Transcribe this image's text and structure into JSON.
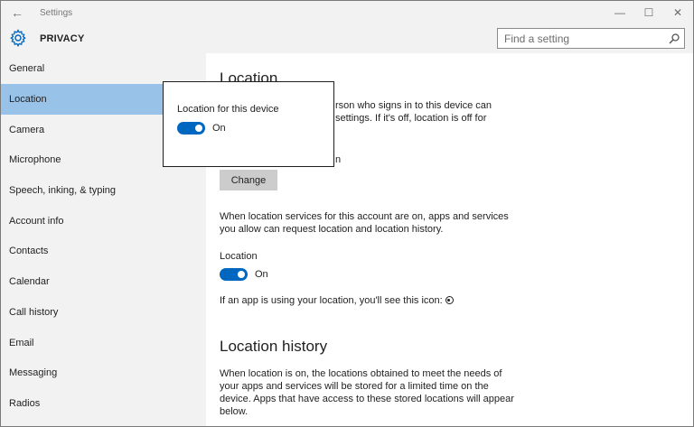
{
  "window": {
    "title": "Settings",
    "back_glyph": "←",
    "minimize_glyph": "—",
    "maximize_glyph": "☐",
    "close_glyph": "✕"
  },
  "header": {
    "section_title": "PRIVACY",
    "search_placeholder": "Find a setting"
  },
  "sidebar": {
    "items": [
      {
        "label": "General"
      },
      {
        "label": "Location"
      },
      {
        "label": "Camera"
      },
      {
        "label": "Microphone"
      },
      {
        "label": "Speech, inking, & typing"
      },
      {
        "label": "Account info"
      },
      {
        "label": "Contacts"
      },
      {
        "label": "Calendar"
      },
      {
        "label": "Call history"
      },
      {
        "label": "Email"
      },
      {
        "label": "Messaging"
      },
      {
        "label": "Radios"
      }
    ],
    "active_index": 1
  },
  "content": {
    "location_heading": "Location",
    "device_para_line1": "rson who signs in to this device can",
    "device_para_line2": "settings. If it's off, location is off for",
    "partial_text": "n",
    "change_button": "Change",
    "account_para_line1": "When location services for this account are on, apps and services",
    "account_para_line2": "you allow can request location and location history.",
    "location_toggle_title": "Location",
    "location_toggle_state": "On",
    "icon_hint": "If an app is using your location, you'll see this icon:",
    "history_heading": "Location history",
    "history_para_line1": "When location is on, the locations obtained to meet the needs of",
    "history_para_line2": "your apps and services will be stored for a limited time on the",
    "history_para_line3": "device. Apps that have access to these stored locations will appear",
    "history_para_line4": "below."
  },
  "popup": {
    "title": "Location for this device",
    "toggle_state": "On"
  },
  "colors": {
    "accent": "#0067c0",
    "nav_active": "#99c2e8",
    "chrome_bg": "#f2f2f2",
    "button_bg": "#cccccc"
  }
}
